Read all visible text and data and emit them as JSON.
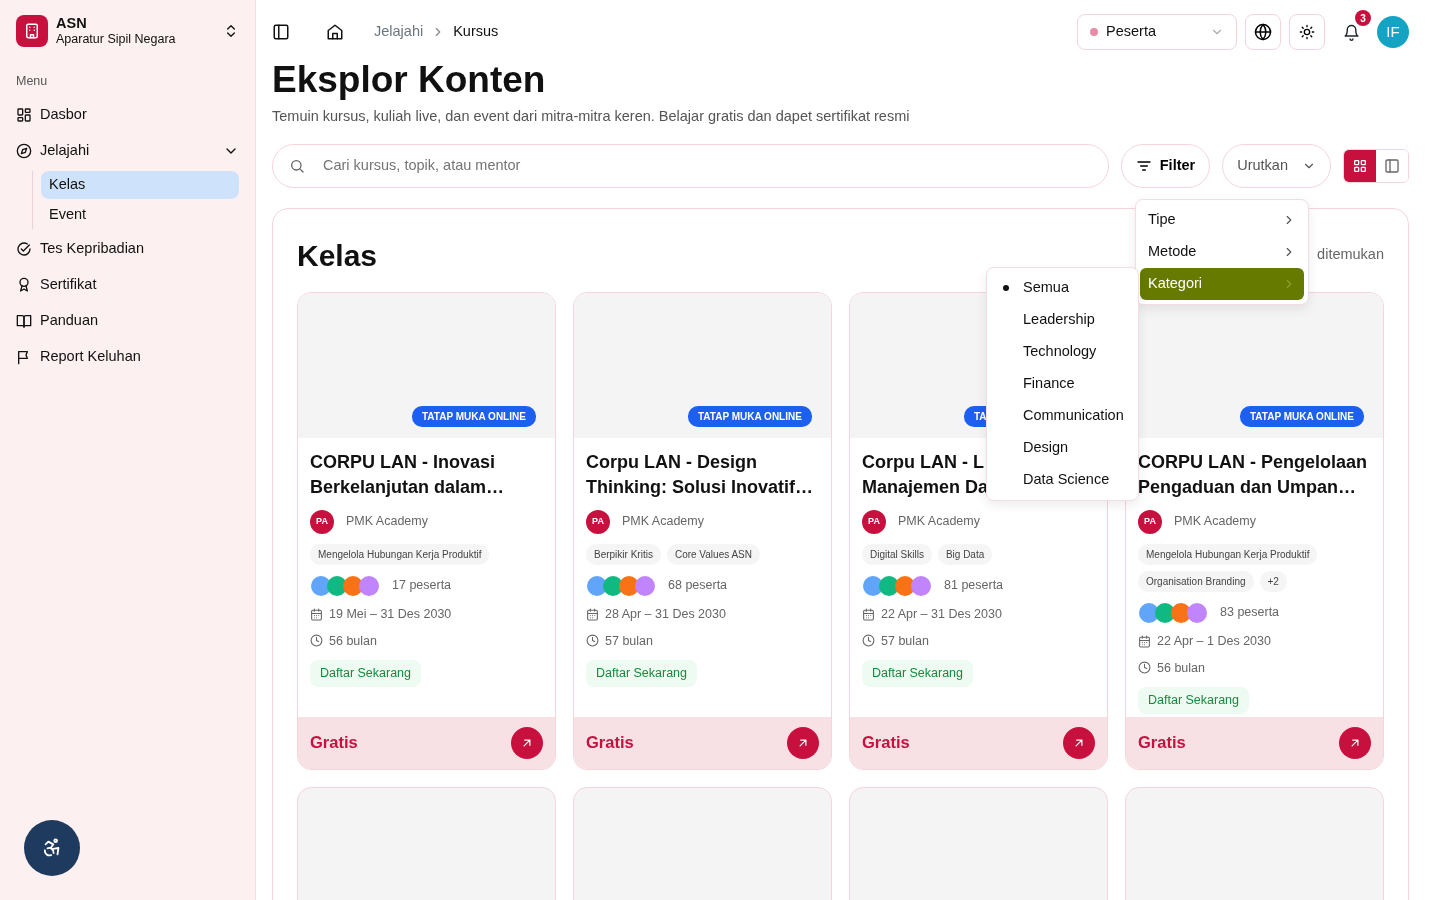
{
  "brand": {
    "title": "ASN",
    "subtitle": "Aparatur Sipil Negara"
  },
  "sidebar": {
    "section_label": "Menu",
    "items": [
      {
        "label": "Dasbor",
        "selected": false
      },
      {
        "label": "Jelajahi",
        "selected": false,
        "expanded": true,
        "children": [
          {
            "label": "Kelas",
            "selected": true
          },
          {
            "label": "Event",
            "selected": false
          }
        ]
      },
      {
        "label": "Tes Kepribadian",
        "selected": false
      },
      {
        "label": "Sertifikat",
        "selected": false
      },
      {
        "label": "Panduan",
        "selected": false
      },
      {
        "label": "Report Keluhan",
        "selected": false
      }
    ]
  },
  "topbar": {
    "breadcrumbs": [
      "Jelajahi",
      "Kursus"
    ],
    "role_select": {
      "value": "Peserta"
    },
    "notifications": {
      "count": "3"
    },
    "avatar": {
      "initials": "IF"
    }
  },
  "page": {
    "title": "Eksplor Konten",
    "subtitle": "Temuin kursus, kuliah live, dan event dari mitra-mitra keren. Belajar gratis dan dapet sertifikat resmi"
  },
  "search": {
    "placeholder": "Cari kursus, topik, atau mentor"
  },
  "filter_button": {
    "label": "Filter"
  },
  "sort_select": {
    "value": "Urutkan"
  },
  "view_toggle": [
    {
      "selected": true
    },
    {
      "selected": false
    }
  ],
  "section": {
    "title": "Kelas",
    "result_text": "ditemukan"
  },
  "cards": [
    {
      "badge": "TATAP MUKA ONLINE",
      "title_lines": [
        "CORPU LAN - Inovasi",
        "Berkelanjutan dalam…"
      ],
      "provider": {
        "initials": "PA",
        "name": "PMK Academy"
      },
      "tags": [
        "Mengelola Hubungan Kerja Produktif"
      ],
      "participants": "17 peserta",
      "dates": "19 Mei – 31 Des 2030",
      "duration": "56 bulan",
      "status": "Daftar Sekarang",
      "price": "Gratis"
    },
    {
      "badge": "TATAP MUKA ONLINE",
      "title_lines": [
        "Corpu LAN - Design",
        "Thinking: Solusi Inovatif…"
      ],
      "provider": {
        "initials": "PA",
        "name": "PMK Academy"
      },
      "tags": [
        "Berpikir Kritis",
        "Core Values ASN"
      ],
      "participants": "68 peserta",
      "dates": "28 Apr – 31 Des 2030",
      "duration": "57 bulan",
      "status": "Daftar Sekarang",
      "price": "Gratis"
    },
    {
      "badge": "TA",
      "title_lines": [
        "Corpu LAN - L",
        "Manajemen Da"
      ],
      "provider": {
        "initials": "PA",
        "name": "PMK Academy"
      },
      "tags": [
        "Digital Skills",
        "Big Data"
      ],
      "participants": "81 peserta",
      "dates": "22 Apr – 31 Des 2030",
      "duration": "57 bulan",
      "status": "Daftar Sekarang",
      "price": "Gratis"
    },
    {
      "badge": "TATAP MUKA ONLINE",
      "title_lines": [
        "CORPU LAN - Pengelolaan",
        "Pengaduan dan Umpan…"
      ],
      "provider": {
        "initials": "PA",
        "name": "PMK Academy"
      },
      "tags": [
        "Mengelola Hubungan Kerja Produktif",
        "Organisation Branding",
        "+2"
      ],
      "participants": "83 peserta",
      "dates": "22 Apr – 1 Des 2030",
      "duration": "56 bulan",
      "status": "Daftar Sekarang",
      "price": "Gratis"
    }
  ],
  "more_cards": [
    {
      "kind": "empty"
    },
    {
      "kind": "empty"
    },
    {
      "kind": "empty"
    },
    {
      "kind": "empty"
    }
  ],
  "filter_menu": {
    "items": [
      {
        "label": "Tipe",
        "selected": false
      },
      {
        "label": "Metode",
        "selected": false
      },
      {
        "label": "Kategori",
        "selected": true
      }
    ]
  },
  "category_menu": {
    "items": [
      {
        "label": "Semua",
        "selected": true
      },
      {
        "label": "Leadership",
        "selected": false
      },
      {
        "label": "Technology",
        "selected": false
      },
      {
        "label": "Finance",
        "selected": false
      },
      {
        "label": "Communication",
        "selected": false
      },
      {
        "label": "Design",
        "selected": false
      },
      {
        "label": "Data Science",
        "selected": false
      }
    ]
  }
}
